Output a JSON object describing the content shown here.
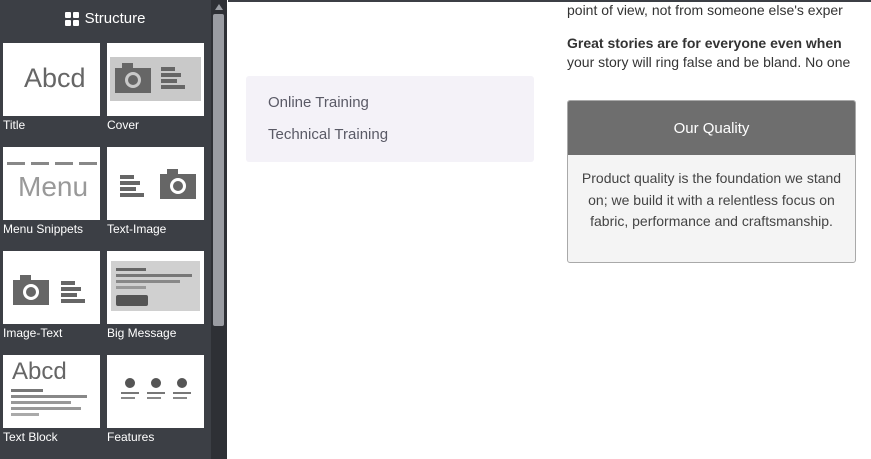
{
  "panel": {
    "title": "Structure",
    "snippets": [
      {
        "label": "Title",
        "thumb_text": "Abcd"
      },
      {
        "label": "Cover"
      },
      {
        "label": "Menu Snippets",
        "thumb_text": "Menu"
      },
      {
        "label": "Text-Image"
      },
      {
        "label": "Image-Text"
      },
      {
        "label": "Big Message"
      },
      {
        "label": "Text Block",
        "thumb_text": "Abcd"
      },
      {
        "label": "Features"
      }
    ]
  },
  "training": {
    "links": [
      "Online Training",
      "Technical Training"
    ]
  },
  "story": {
    "line1": "point of view, not from someone else's exper",
    "line2_bold": "Great stories are for everyone even when",
    "line3": "your story will ring false and be bland. No one"
  },
  "quality": {
    "title": "Our Quality",
    "body": "Product quality is the foundation we stand on; we build it with a relentless focus on fabric, performance and craftsmanship."
  },
  "colors": {
    "panel_bg": "#3c3f45",
    "card_header": "#6e6e6e",
    "training_bg": "#f4f2f8"
  }
}
